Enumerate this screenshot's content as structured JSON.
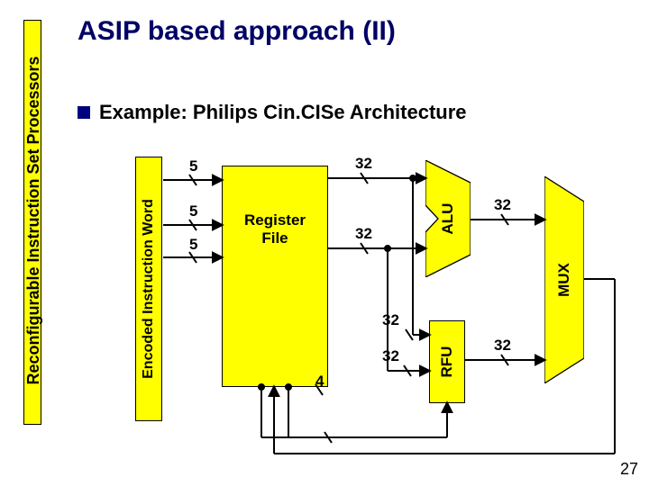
{
  "side_panel": {
    "label": "Reconfigurable Instruction Set Processors"
  },
  "title": "ASIP based approach (II)",
  "bullet": {
    "text": "Example: Philips Cin.CISe Architecture"
  },
  "diagram": {
    "eiw_label": "Encoded Instruction Word",
    "reg_file": "Register\nFile",
    "alu": "ALU",
    "rfu": "RFU",
    "mux": "MUX",
    "addr_bits": {
      "a": "5",
      "b": "5",
      "c": "5"
    },
    "data_bits": {
      "rf_out_top": "32",
      "rf_out_bot": "32",
      "alu_out": "32",
      "rfu_in_top": "32",
      "rfu_in_bot": "32",
      "rfu_out": "32",
      "rfu_ctrl": "4"
    }
  },
  "page": "27"
}
